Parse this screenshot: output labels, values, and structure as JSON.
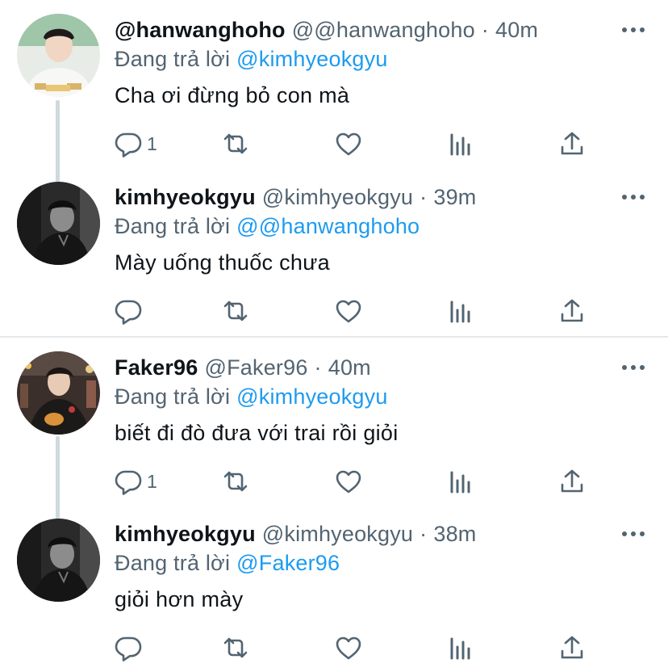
{
  "threads": [
    {
      "tweets": [
        {
          "display_name": "@hanwanghoho",
          "handle": "@@hanwanghoho",
          "separator": "·",
          "time": "40m",
          "reply_prefix": "Đang trả lời",
          "reply_to": "@kimhyeokgyu",
          "text": "Cha ơi đừng bỏ con mà",
          "reply_count": "1"
        },
        {
          "display_name": "kimhyeokgyu",
          "handle": "@kimhyeokgyu",
          "separator": "·",
          "time": "39m",
          "reply_prefix": "Đang trả lời",
          "reply_to": "@@hanwanghoho",
          "text": "Mày uống thuốc chưa",
          "reply_count": ""
        }
      ]
    },
    {
      "tweets": [
        {
          "display_name": "Faker96",
          "handle": "@Faker96",
          "separator": "·",
          "time": "40m",
          "reply_prefix": "Đang trả lời",
          "reply_to": "@kimhyeokgyu",
          "text": "biết đi đò đưa với trai rồi giỏi",
          "reply_count": "1"
        },
        {
          "display_name": "kimhyeokgyu",
          "handle": "@kimhyeokgyu",
          "separator": "·",
          "time": "38m",
          "reply_prefix": "Đang trả lời",
          "reply_to": "@Faker96",
          "text": "giỏi hơn mày",
          "reply_count": ""
        }
      ]
    }
  ],
  "icons": {
    "more": "more-horizontal-icon",
    "reply": "reply-bubble-icon",
    "retweet": "retweet-icon",
    "like": "heart-icon",
    "stats": "stats-bar-icon",
    "share": "share-upload-icon"
  },
  "colors": {
    "text": "#0f1419",
    "secondary": "#536471",
    "link": "#1d9bf0",
    "connector": "#cfd9de",
    "divider": "#e4e7ea"
  }
}
